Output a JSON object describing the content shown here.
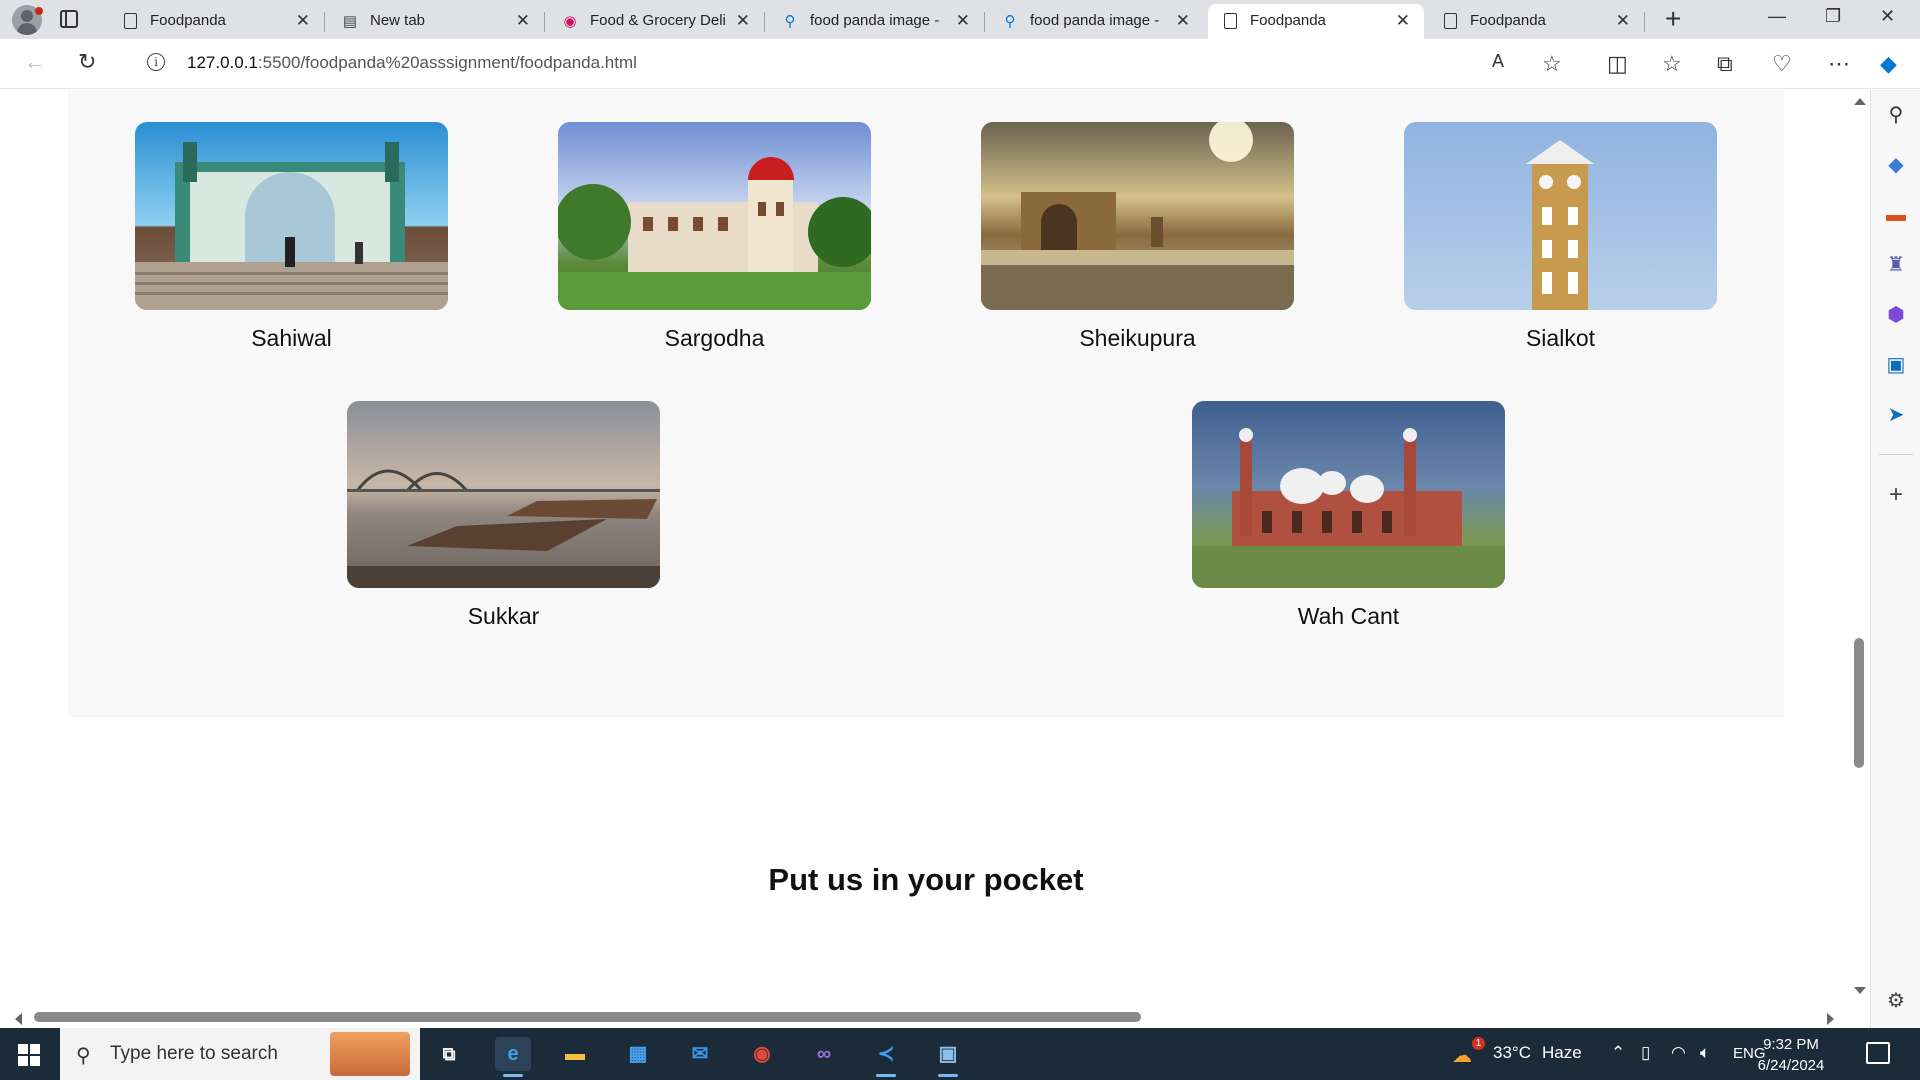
{
  "browser": {
    "tabs": [
      {
        "label": "Foodpanda",
        "icon": "page-icon",
        "active": false
      },
      {
        "label": "New tab",
        "icon": "newtab-icon",
        "active": false
      },
      {
        "label": "Food & Grocery Deli",
        "icon": "foodpanda-icon",
        "active": false
      },
      {
        "label": "food panda image - ",
        "icon": "search-icon",
        "active": false
      },
      {
        "label": "food panda image - ",
        "icon": "search-icon",
        "active": false
      },
      {
        "label": "Foodpanda",
        "icon": "page-icon",
        "active": true
      },
      {
        "label": "Foodpanda",
        "icon": "page-icon",
        "active": false
      }
    ],
    "url_host": "127.0.0.1",
    "url_rest": ":5500/foodpanda%20asssignment/foodpanda.html"
  },
  "page": {
    "cities_row1": [
      {
        "name": "Sahiwal"
      },
      {
        "name": "Sargodha"
      },
      {
        "name": "Sheikupura"
      },
      {
        "name": "Sialkot"
      }
    ],
    "cities_row2": [
      {
        "name": "Sukkar"
      },
      {
        "name": "Wah Cant"
      }
    ],
    "pocket_heading": "Put us in your pocket"
  },
  "taskbar": {
    "search_placeholder": "Type here to search",
    "weather_temp": "33°C",
    "weather_desc": "Haze",
    "language": "ENG",
    "time": "9:32 PM",
    "date": "6/24/2024",
    "weather_badge": "1"
  },
  "colors": {
    "accent": "#0078d4",
    "tab_strip": "#dfe1e5",
    "section_bg": "#f8f8f8",
    "taskbar": "#1c2b3a"
  }
}
